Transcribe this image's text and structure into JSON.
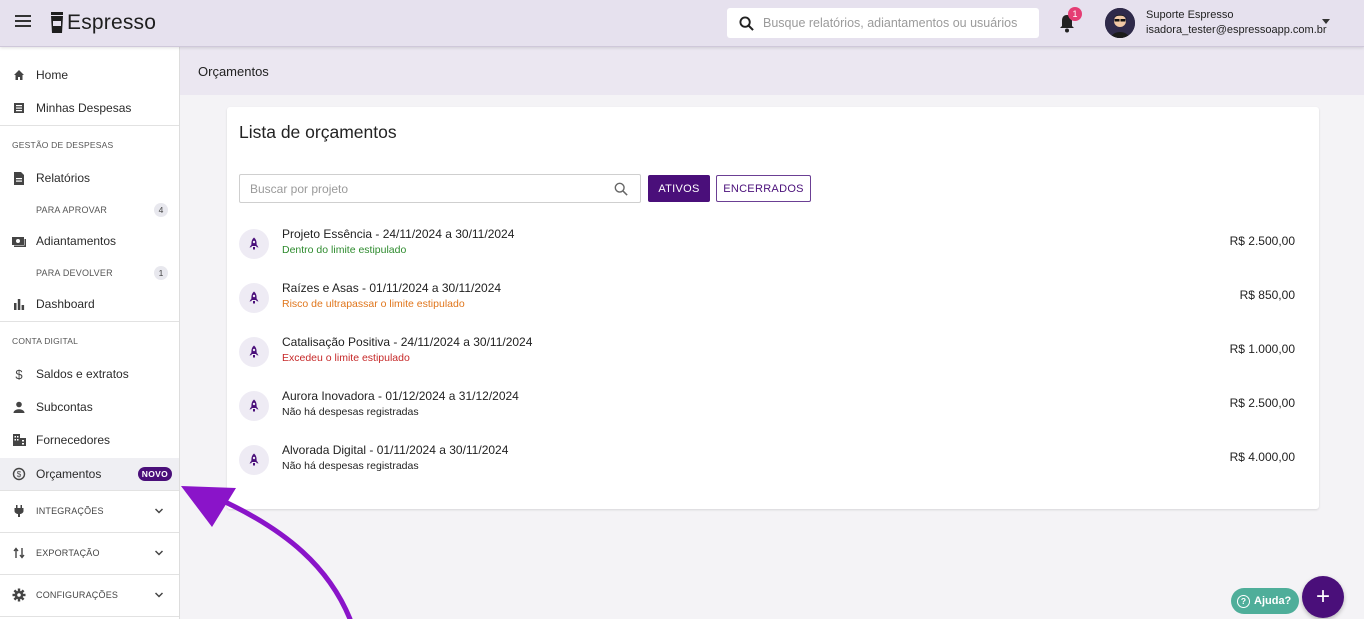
{
  "topbar": {
    "logo_text": "Espresso",
    "search_placeholder": "Busque relatórios, adiantamentos ou usuários",
    "notification_count": "1",
    "user_name": "Suporte Espresso",
    "user_email": "isadora_tester@espressoapp.com.br"
  },
  "sidebar": {
    "home": "Home",
    "minhas_despesas": "Minhas Despesas",
    "section_gestao": "GESTÃO DE DESPESAS",
    "relatorios": "Relatórios",
    "para_aprovar": "PARA APROVAR",
    "para_aprovar_count": "4",
    "adiantamentos": "Adiantamentos",
    "para_devolver": "PARA DEVOLVER",
    "para_devolver_count": "1",
    "dashboard": "Dashboard",
    "section_conta": "CONTA DIGITAL",
    "saldos": "Saldos e extratos",
    "subcontas": "Subcontas",
    "fornecedores": "Fornecedores",
    "orcamentos": "Orçamentos",
    "novo_badge": "NOVO",
    "integracoes": "INTEGRAÇÕES",
    "exportacao": "EXPORTAÇÃO",
    "configuracoes": "CONFIGURAÇÕES"
  },
  "content": {
    "breadcrumb": "Orçamentos",
    "card_title": "Lista de orçamentos",
    "project_search_placeholder": "Buscar por projeto",
    "btn_ativos": "ATIVOS",
    "btn_encerrados": "ENCERRADOS",
    "budgets": [
      {
        "title": "Projeto Essência - 24/11/2024 a 30/11/2024",
        "status": "Dentro do limite estipulado",
        "status_color": "#2e8b2e",
        "amount": "R$ 2.500,00"
      },
      {
        "title": "Raízes e Asas - 01/11/2024 a 30/11/2024",
        "status": "Risco de ultrapassar o limite estipulado",
        "status_color": "#e0761c",
        "amount": "R$ 850,00"
      },
      {
        "title": "Catalisação Positiva - 24/11/2024 a 30/11/2024",
        "status": "Excedeu o limite estipulado",
        "status_color": "#c62828",
        "amount": "R$ 1.000,00"
      },
      {
        "title": "Aurora Inovadora - 01/12/2024 a 31/12/2024",
        "status": "Não há despesas registradas",
        "status_color": "#222222",
        "amount": "R$ 2.500,00"
      },
      {
        "title": "Alvorada Digital - 01/11/2024 a 30/11/2024",
        "status": "Não há despesas registradas",
        "status_color": "#222222",
        "amount": "R$ 4.000,00"
      }
    ]
  },
  "floating": {
    "help_label": "Ajuda?",
    "fab_label": "+"
  },
  "colors": {
    "brand": "#4a0f7a",
    "topbar_bg": "#e6e1ee",
    "help_bg": "#4fae9a",
    "arrow": "#8a14c9"
  },
  "icons": [
    "menu-icon",
    "coffee-cup-icon",
    "search-icon",
    "bell-icon",
    "home-icon",
    "receipt-icon",
    "document-icon",
    "cash-icon",
    "bar-chart-icon",
    "dollar-icon",
    "person-icon",
    "building-icon",
    "budget-icon",
    "plug-icon",
    "transfer-icon",
    "gear-icon",
    "chevron-down-icon",
    "rocket-icon",
    "help-icon",
    "plus-icon"
  ]
}
